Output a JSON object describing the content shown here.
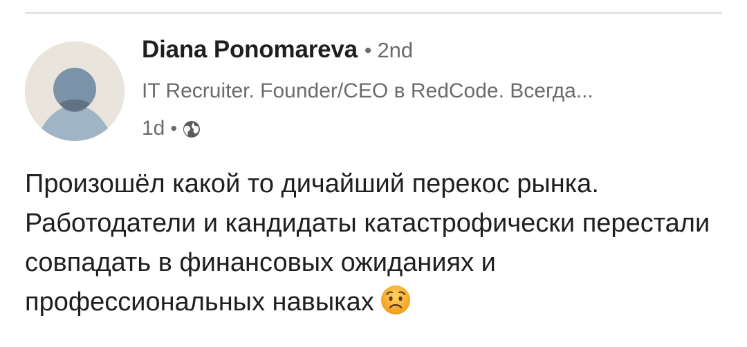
{
  "post": {
    "author": {
      "name": "Diana Ponomareva",
      "bullet": "•",
      "connection_degree": "2nd",
      "headline": "IT Recruiter. Founder/CEO в RedCode. Всегда...",
      "avatar_icon": "default-person-avatar"
    },
    "meta": {
      "timestamp": "1d",
      "bullet": "•",
      "visibility_icon": "globe-icon"
    },
    "body": {
      "text": "Произошёл какой то дичайший перекос рынка. Работодатели и кандидаты катастрофически перестали совпадать в финансовых ожиданиях и профессиональных навыках",
      "emoji": "worried-face"
    }
  },
  "colors": {
    "text_primary": "#1f1f1f",
    "text_secondary": "#6b6b6b",
    "avatar_bg": "#e9e5dc",
    "avatar_head": "#7a93a8",
    "avatar_body": "#9fb5c7",
    "divider": "#e3e3e3",
    "emoji_fill": "#f6a623"
  }
}
